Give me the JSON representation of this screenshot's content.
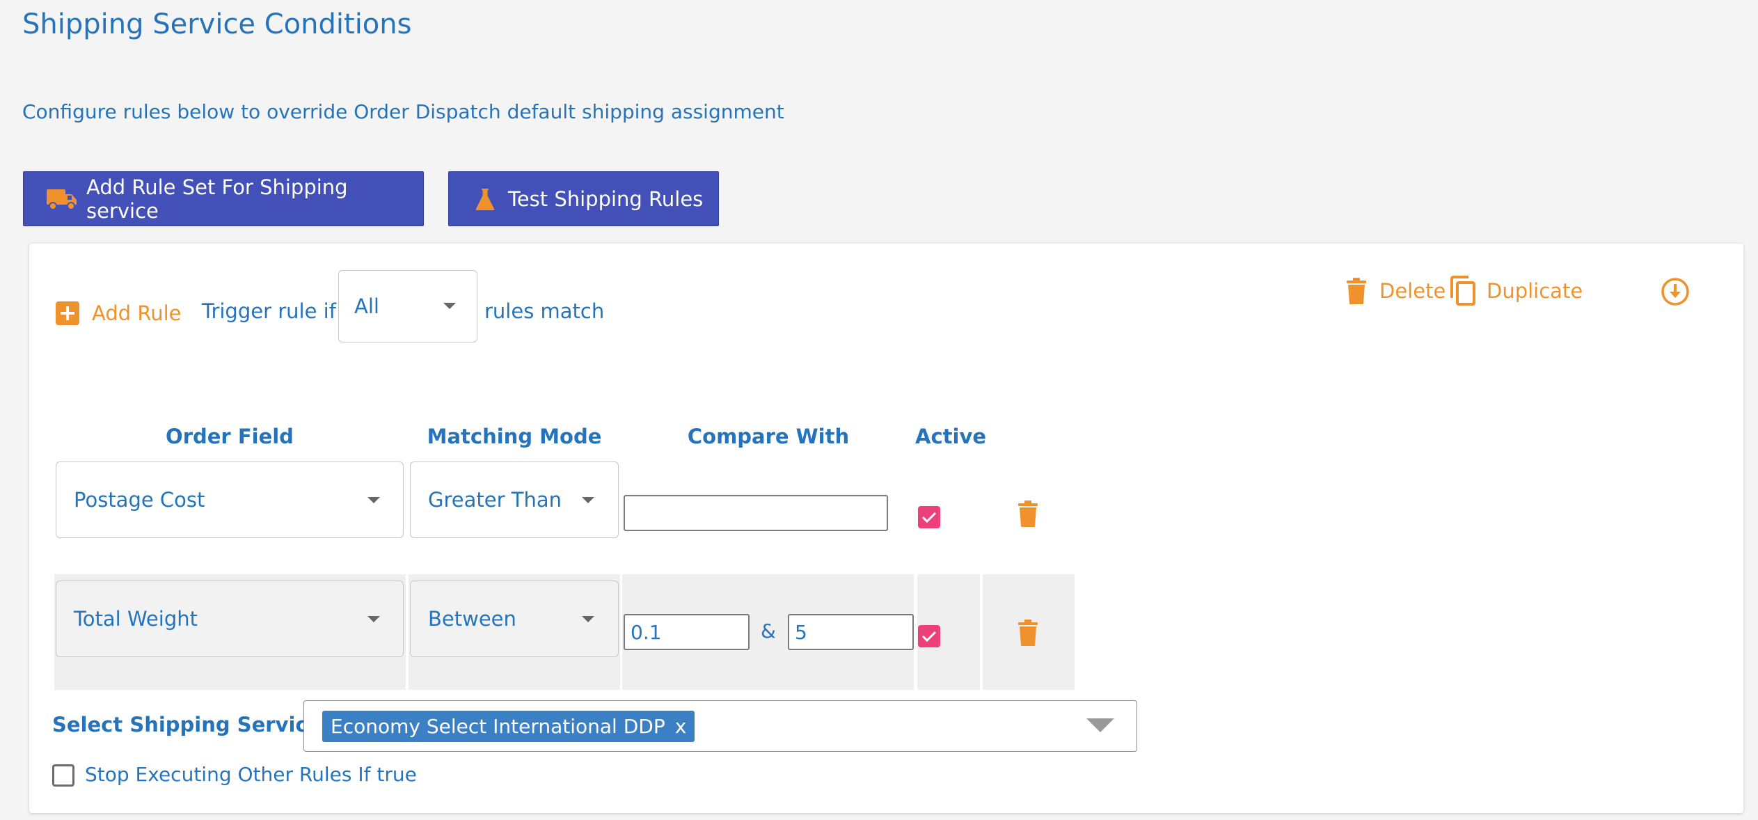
{
  "page": {
    "title": "Shipping Service Conditions",
    "subtitle": "Configure rules below to override Order Dispatch default shipping assignment"
  },
  "toolbar": {
    "add_rule_set_label": "Add Rule Set For Shipping service",
    "test_rules_label": "Test Shipping Rules"
  },
  "ruleset": {
    "add_rule_label": "Add Rule",
    "trigger_prefix": "Trigger rule if",
    "trigger_value": "All",
    "trigger_suffix": "rules match",
    "delete_label": "Delete",
    "duplicate_label": "Duplicate",
    "columns": {
      "order_field": "Order Field",
      "matching_mode": "Matching Mode",
      "compare_with": "Compare With",
      "active": "Active"
    },
    "rules": [
      {
        "order_field": "Postage Cost",
        "matching_mode": "Greater Than",
        "compare_value": "",
        "active": true
      },
      {
        "order_field": "Total Weight",
        "matching_mode": "Between",
        "compare_from": "0.1",
        "separator": "&",
        "compare_to": "5",
        "active": true
      }
    ],
    "shipping_service_label": "Select Shipping Service :",
    "selected_service": "Economy Select International DDP",
    "remove_tag_glyph": "x",
    "stop_executing_label": "Stop Executing Other Rules If true",
    "stop_executing_checked": false
  },
  "colors": {
    "primary_button": "#4350b8",
    "accent_orange": "#f0922b",
    "text_blue": "#2574bb",
    "checkbox_pink": "#ec407a",
    "tag_blue": "#3b7fc4"
  },
  "icons": [
    "truck-icon",
    "flask-icon",
    "plus-square-icon",
    "trash-icon",
    "copy-icon",
    "download-circle-icon",
    "checkmark-icon",
    "chevron-down-icon"
  ]
}
